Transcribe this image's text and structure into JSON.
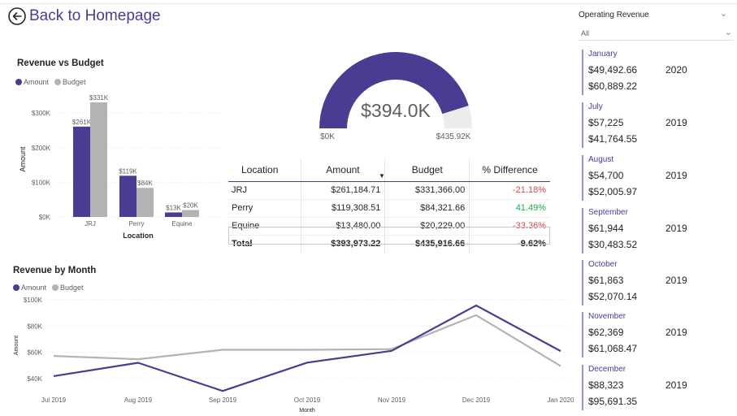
{
  "header": {
    "back_label": "Back to Homepage"
  },
  "slicer": {
    "title": "Operating Revenue",
    "value": "All"
  },
  "cards": [
    {
      "month": "January",
      "amount": "$49,492.66",
      "year": "2020",
      "budget": "$60,889.22"
    },
    {
      "month": "July",
      "amount": "$57,225",
      "year": "2019",
      "budget": "$41,764.55"
    },
    {
      "month": "August",
      "amount": "$54,700",
      "year": "2019",
      "budget": "$52,005.97"
    },
    {
      "month": "September",
      "amount": "$61,944",
      "year": "2019",
      "budget": "$30,483.52"
    },
    {
      "month": "October",
      "amount": "$61,863",
      "year": "2019",
      "budget": "$52,070.14"
    },
    {
      "month": "November",
      "amount": "$62,369",
      "year": "2019",
      "budget": "$61,068.47"
    },
    {
      "month": "December",
      "amount": "$88,323",
      "year": "2019",
      "budget": "$95,691.35"
    }
  ],
  "legend": {
    "amount": "Amount",
    "budget": "Budget"
  },
  "colors": {
    "amount": "#4b3c93",
    "budget": "#b3b3b3",
    "accent": "#4b3c93",
    "negative": "#d64550",
    "positive": "#1aab40"
  },
  "table": {
    "headers": [
      "Location",
      "Amount",
      "Budget",
      "% Difference"
    ],
    "rows": [
      {
        "location": "JRJ",
        "amount": "$261,184.71",
        "budget": "$331,366.00",
        "diff": "-21.18%"
      },
      {
        "location": "Perry",
        "amount": "$119,308.51",
        "budget": "$84,321.66",
        "diff": "41.49%"
      },
      {
        "location": "Equine",
        "amount": "$13,480.00",
        "budget": "$20,229.00",
        "diff": "-33.36%"
      }
    ],
    "total": {
      "location": "Total",
      "amount": "$393,973.22",
      "budget": "$435,916.66",
      "diff": "-9.62%"
    }
  },
  "chart_data": [
    {
      "type": "bar",
      "title": "Revenue vs Budget",
      "xlabel": "Location",
      "ylabel": "Amount",
      "categories": [
        "JRJ",
        "Perry",
        "Equine"
      ],
      "series": [
        {
          "name": "Amount",
          "values": [
            261,
            119,
            13
          ],
          "labels": [
            "$261K",
            "$119K",
            "$13K"
          ]
        },
        {
          "name": "Budget",
          "values": [
            331,
            84,
            20
          ],
          "labels": [
            "$331K",
            "$84K",
            "$20K"
          ]
        }
      ],
      "ylim": [
        0,
        331
      ],
      "yticks": [
        0,
        100,
        200,
        300
      ],
      "ytick_labels": [
        "$0K",
        "$100K",
        "$200K",
        "$300K"
      ],
      "grid": true,
      "legend": "top-left"
    },
    {
      "type": "gauge",
      "value": 393973.22,
      "max": 435916.66,
      "value_label": "$394.0K",
      "min_label": "$0K",
      "max_label": "$435.92K"
    },
    {
      "type": "line",
      "title": "Revenue by Month",
      "xlabel": "Month",
      "ylabel": "Amount",
      "x": [
        "Jul 2019",
        "Aug 2019",
        "Sep 2019",
        "Oct 2019",
        "Nov 2019",
        "Dec 2019",
        "Jan 2020"
      ],
      "series": [
        {
          "name": "Amount",
          "values": [
            41.8,
            52.0,
            30.5,
            52.1,
            61.1,
            95.7,
            60.9
          ]
        },
        {
          "name": "Budget",
          "values": [
            57.2,
            54.7,
            61.9,
            61.9,
            62.4,
            88.3,
            49.5
          ]
        }
      ],
      "ylim": [
        30,
        100
      ],
      "yticks": [
        40,
        60,
        80,
        100
      ],
      "ytick_labels": [
        "$40K",
        "$60K",
        "$80K",
        "$100K"
      ],
      "grid": true,
      "legend": "top-left"
    }
  ]
}
